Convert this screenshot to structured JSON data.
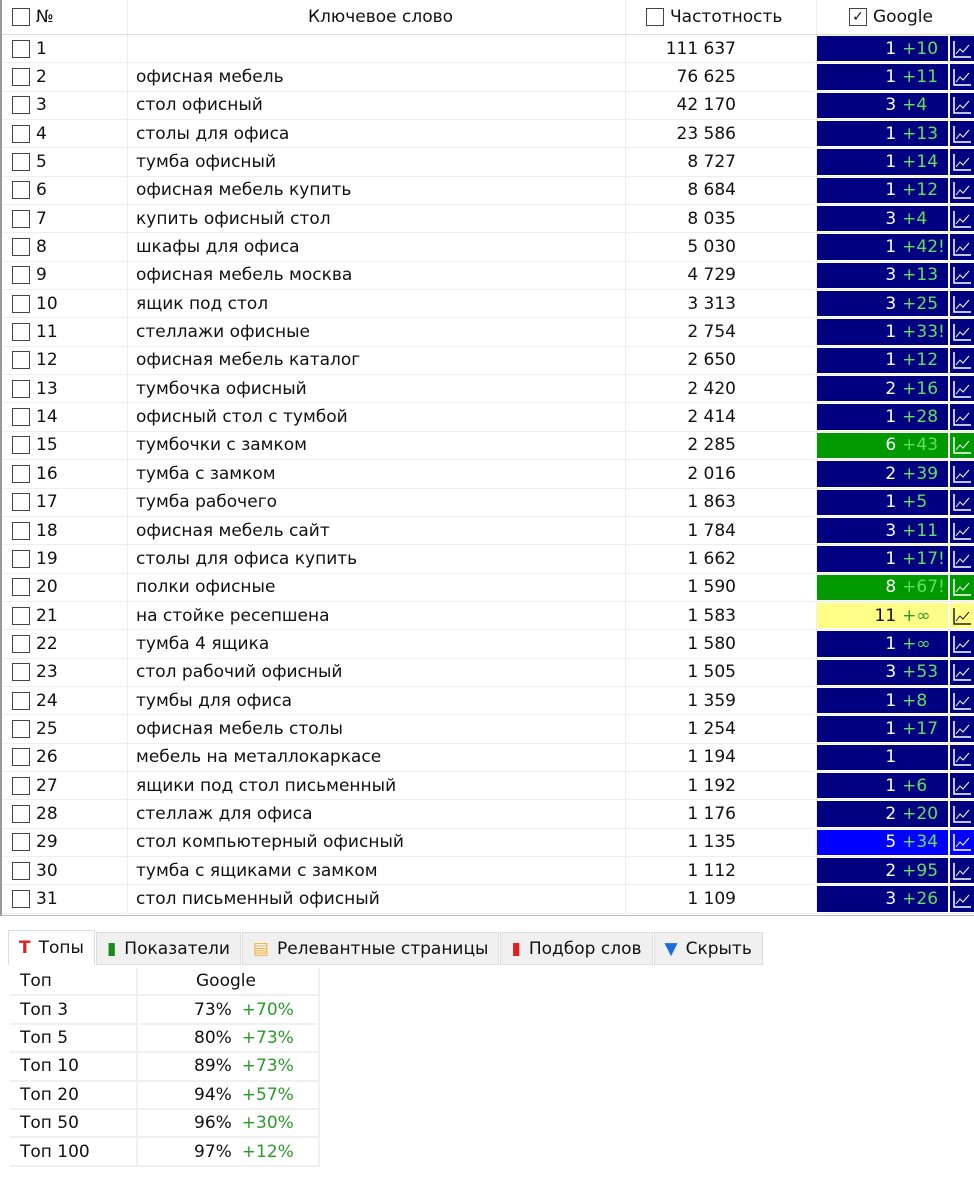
{
  "header": {
    "num": "№",
    "keyword": "Ключевое слово",
    "frequency": "Частотность",
    "google": "Google"
  },
  "colors": {
    "navy": "#000080",
    "green": "#009900",
    "yellow": "#ffff88",
    "blue": "#0000ff"
  },
  "rows": [
    {
      "n": "1",
      "kw": "",
      "f": "111 637",
      "p": "1",
      "d": "+10",
      "c": "navy"
    },
    {
      "n": "2",
      "kw": "офисная мебель",
      "f": "76 625",
      "p": "1",
      "d": "+11",
      "c": "navy"
    },
    {
      "n": "3",
      "kw": "стол офисный",
      "f": "42 170",
      "p": "3",
      "d": "+4",
      "c": "navy"
    },
    {
      "n": "4",
      "kw": "столы для офиса",
      "f": "23 586",
      "p": "1",
      "d": "+13",
      "c": "navy"
    },
    {
      "n": "5",
      "kw": "тумба офисный",
      "f": "8 727",
      "p": "1",
      "d": "+14",
      "c": "navy"
    },
    {
      "n": "6",
      "kw": "офисная мебель купить",
      "f": "8 684",
      "p": "1",
      "d": "+12",
      "c": "navy"
    },
    {
      "n": "7",
      "kw": "купить офисный стол",
      "f": "8 035",
      "p": "3",
      "d": "+4",
      "c": "navy"
    },
    {
      "n": "8",
      "kw": "шкафы для офиса",
      "f": "5 030",
      "p": "1",
      "d": "+42!",
      "c": "navy"
    },
    {
      "n": "9",
      "kw": "офисная мебель москва",
      "f": "4 729",
      "p": "3",
      "d": "+13",
      "c": "navy"
    },
    {
      "n": "10",
      "kw": "ящик под стол",
      "f": "3 313",
      "p": "3",
      "d": "+25",
      "c": "navy"
    },
    {
      "n": "11",
      "kw": "стеллажи офисные",
      "f": "2 754",
      "p": "1",
      "d": "+33!",
      "c": "navy"
    },
    {
      "n": "12",
      "kw": "офисная мебель каталог",
      "f": "2 650",
      "p": "1",
      "d": "+12",
      "c": "navy"
    },
    {
      "n": "13",
      "kw": "тумбочка офисный",
      "f": "2 420",
      "p": "2",
      "d": "+16",
      "c": "navy"
    },
    {
      "n": "14",
      "kw": "офисный стол с тумбой",
      "f": "2 414",
      "p": "1",
      "d": "+28",
      "c": "navy"
    },
    {
      "n": "15",
      "kw": "тумбочки с замком",
      "f": "2 285",
      "p": "6",
      "d": "+43",
      "c": "green"
    },
    {
      "n": "16",
      "kw": "тумба с замком",
      "f": "2 016",
      "p": "2",
      "d": "+39",
      "c": "navy"
    },
    {
      "n": "17",
      "kw": "тумба рабочего",
      "f": "1 863",
      "p": "1",
      "d": "+5",
      "c": "navy"
    },
    {
      "n": "18",
      "kw": "офисная мебель сайт",
      "f": "1 784",
      "p": "3",
      "d": "+11",
      "c": "navy"
    },
    {
      "n": "19",
      "kw": "столы для офиса купить",
      "f": "1 662",
      "p": "1",
      "d": "+17!",
      "c": "navy"
    },
    {
      "n": "20",
      "kw": "полки офисные",
      "f": "1 590",
      "p": "8",
      "d": "+67!",
      "c": "green"
    },
    {
      "n": "21",
      "kw": "на стойке ресепшена",
      "f": "1 583",
      "p": "11",
      "d": "+∞",
      "c": "yellow"
    },
    {
      "n": "22",
      "kw": "тумба 4 ящика",
      "f": "1 580",
      "p": "1",
      "d": "+∞",
      "c": "navy"
    },
    {
      "n": "23",
      "kw": "стол рабочий офисный",
      "f": "1 505",
      "p": "3",
      "d": "+53",
      "c": "navy"
    },
    {
      "n": "24",
      "kw": "тумбы для офиса",
      "f": "1 359",
      "p": "1",
      "d": "+8",
      "c": "navy"
    },
    {
      "n": "25",
      "kw": "офисная мебель столы",
      "f": "1 254",
      "p": "1",
      "d": "+17",
      "c": "navy"
    },
    {
      "n": "26",
      "kw": "мебель на металлокаркасе",
      "f": "1 194",
      "p": "1",
      "d": "",
      "c": "navy"
    },
    {
      "n": "27",
      "kw": "ящики под стол письменный",
      "f": "1 192",
      "p": "1",
      "d": "+6",
      "c": "navy"
    },
    {
      "n": "28",
      "kw": "стеллаж для офиса",
      "f": "1 176",
      "p": "2",
      "d": "+20",
      "c": "navy"
    },
    {
      "n": "29",
      "kw": "стол компьютерный офисный",
      "f": "1 135",
      "p": "5",
      "d": "+34",
      "c": "blue"
    },
    {
      "n": "30",
      "kw": "тумба с ящиками с замком",
      "f": "1 112",
      "p": "2",
      "d": "+95",
      "c": "navy"
    },
    {
      "n": "31",
      "kw": "стол письменный офисный",
      "f": "1 109",
      "p": "3",
      "d": "+26",
      "c": "navy"
    }
  ],
  "tabs": [
    {
      "label": "Топы",
      "icon": "T",
      "color": "#e02020",
      "name": "tops"
    },
    {
      "label": "Показатели",
      "icon": "▮",
      "color": "#1a8a1a",
      "name": "indicators"
    },
    {
      "label": "Релевантные страницы",
      "icon": "▤",
      "color": "#f0b030",
      "name": "relevant-pages"
    },
    {
      "label": "Подбор слов",
      "icon": "▮",
      "color": "#e02020",
      "name": "word-selection"
    },
    {
      "label": "Скрыть",
      "icon": "▼",
      "color": "#1a6ae0",
      "name": "hide"
    }
  ],
  "tops": {
    "col1": "Топ",
    "col2": "Google",
    "rows": [
      {
        "t": "Топ 3",
        "v": "73%",
        "d": "+70%"
      },
      {
        "t": "Топ 5",
        "v": "80%",
        "d": "+73%"
      },
      {
        "t": "Топ 10",
        "v": "89%",
        "d": "+73%"
      },
      {
        "t": "Топ 20",
        "v": "94%",
        "d": "+57%"
      },
      {
        "t": "Топ 50",
        "v": "96%",
        "d": "+30%"
      },
      {
        "t": "Топ 100",
        "v": "97%",
        "d": "+12%"
      }
    ]
  }
}
